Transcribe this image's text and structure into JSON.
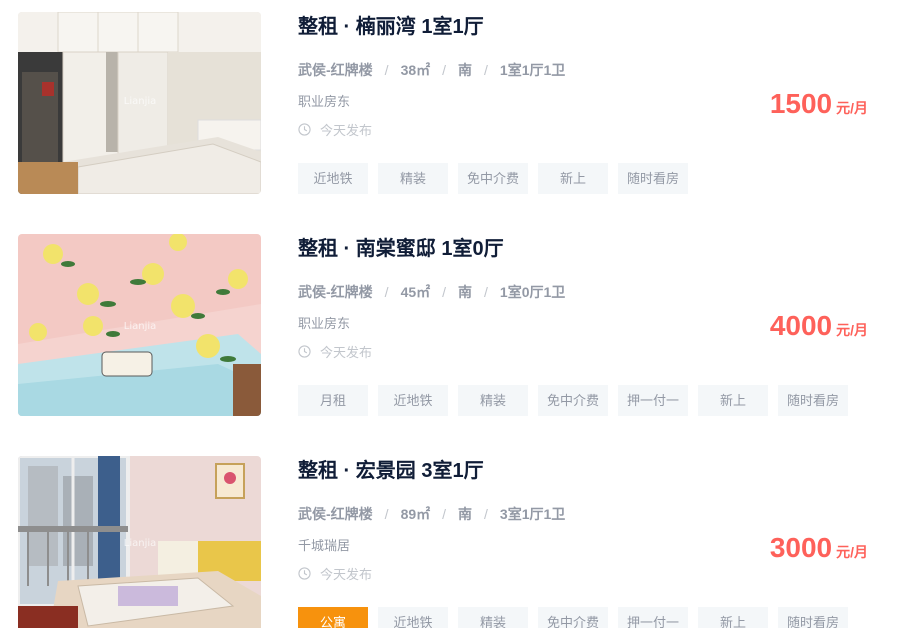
{
  "listings": [
    {
      "title": "整租 · 楠丽湾 1室1厅",
      "location": "武侯-红牌楼",
      "area": "38㎡",
      "orientation": "南",
      "layout": "1室1厅1卫",
      "owner": "职业房东",
      "posted": "今天发布",
      "price": "1500",
      "price_unit": "元/月",
      "tags": [
        "近地铁",
        "精装",
        "免中介费",
        "新上",
        "随时看房"
      ]
    },
    {
      "title": "整租 · 南棠蜜邸 1室0厅",
      "location": "武侯-红牌楼",
      "area": "45㎡",
      "orientation": "南",
      "layout": "1室0厅1卫",
      "owner": "职业房东",
      "posted": "今天发布",
      "price": "4000",
      "price_unit": "元/月",
      "tags": [
        "月租",
        "近地铁",
        "精装",
        "免中介费",
        "押一付一",
        "新上",
        "随时看房"
      ]
    },
    {
      "title": "整租 · 宏景园 3室1厅",
      "location": "武侯-红牌楼",
      "area": "89㎡",
      "orientation": "南",
      "layout": "3室1厅1卫",
      "owner": "千城瑞居",
      "posted": "今天发布",
      "price": "3000",
      "price_unit": "元/月",
      "tags": [
        "公寓",
        "近地铁",
        "精装",
        "免中介费",
        "押一付一",
        "新上",
        "随时看房"
      ]
    }
  ],
  "meta_separator": "/",
  "photo_watermark": "Lianjia",
  "colors": {
    "price": "#fe615a",
    "title": "#101d37",
    "meta": "#9399a5",
    "muted": "#c2c6cc",
    "tag_bg": "#f4f7f9",
    "tag_accent_bg": "#f7920d"
  },
  "icons": {
    "posted": "clock-icon"
  }
}
